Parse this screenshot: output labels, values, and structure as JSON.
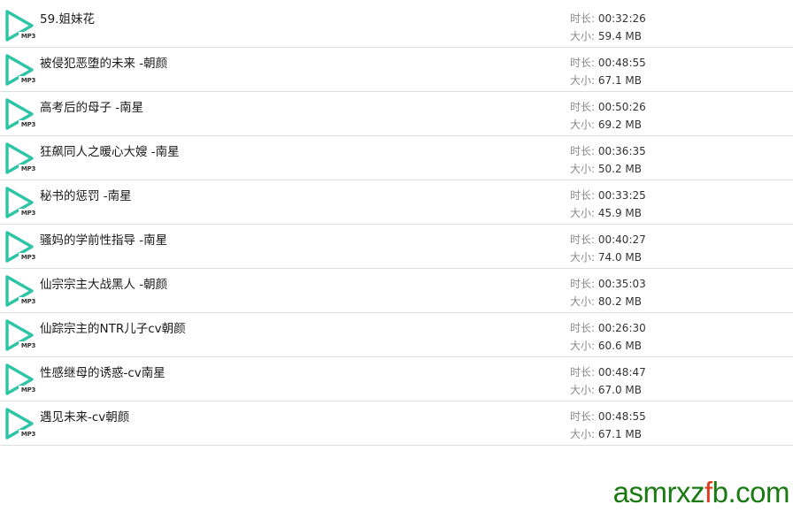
{
  "labels": {
    "duration": "时长: ",
    "size": "大小: ",
    "file_type": "MP3"
  },
  "colors": {
    "icon_accent": "#2ec4a6",
    "watermark_green": "#1a7a12",
    "watermark_accent": "#e0391c"
  },
  "icon": "mp3-play-file-icon",
  "files": [
    {
      "name": "59.姐妹花",
      "duration": "00:32:26",
      "size": "59.4 MB"
    },
    {
      "name": "被侵犯恶堕的未来 -朝颜",
      "duration": "00:48:55",
      "size": "67.1 MB"
    },
    {
      "name": "高考后的母子 -南星",
      "duration": "00:50:26",
      "size": "69.2 MB"
    },
    {
      "name": "狂飙同人之暖心大嫂 -南星",
      "duration": "00:36:35",
      "size": "50.2 MB"
    },
    {
      "name": "秘书的惩罚 -南星",
      "duration": "00:33:25",
      "size": "45.9 MB"
    },
    {
      "name": "骚妈的学前性指导 -南星",
      "duration": "00:40:27",
      "size": "74.0 MB"
    },
    {
      "name": "仙宗宗主大战黑人 -朝颜",
      "duration": "00:35:03",
      "size": "80.2 MB"
    },
    {
      "name": "仙踪宗主的NTR儿子cv朝颜",
      "duration": "00:26:30",
      "size": "60.6 MB"
    },
    {
      "name": "性感继母的诱惑-cv南星",
      "duration": "00:48:47",
      "size": "67.0 MB"
    },
    {
      "name": "遇见未来-cv朝颜",
      "duration": "00:48:55",
      "size": "67.1 MB"
    }
  ],
  "watermark": {
    "prefix": "asmrxz",
    "accent": "f",
    "suffix": "b.com"
  }
}
